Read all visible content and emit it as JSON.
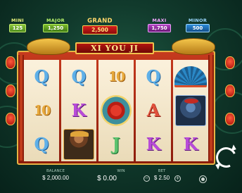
{
  "game": {
    "title": "XI YOU JI"
  },
  "jackpots": {
    "mini": {
      "label": "MINI",
      "value": "125"
    },
    "major": {
      "label": "MAJOR",
      "value": "1,250"
    },
    "grand": {
      "label": "GRAND",
      "value": "2,500"
    },
    "maxi": {
      "label": "MAXI",
      "value": "1,750"
    },
    "minor": {
      "label": "MINOR",
      "value": "500"
    }
  },
  "reels": {
    "reel1": [
      "Q",
      "10",
      "Q"
    ],
    "reel2": [
      "Q",
      "K",
      "monkey-king"
    ],
    "reel3": [
      "10",
      "scroll-scatter",
      "J"
    ],
    "reel4": [
      "Q",
      "A",
      "K"
    ],
    "reel5": [
      "fan",
      "warrior",
      "K"
    ]
  },
  "symbol_colors": {
    "Q": "#5fb0e8",
    "10": "#e8a93c",
    "K": "#b84bd8",
    "A": "#e0503c",
    "J": "#5bc26e"
  },
  "bottom_bar": {
    "balance_label": "BALANCE",
    "balance_value": "$ 2,000.00",
    "win_label": "WIN",
    "win_value": "$ 0.00",
    "bet_label": "BET",
    "bet_value": "$ 2.50",
    "bet_minus": "−",
    "bet_plus": "+"
  },
  "icons": {
    "spin": "spin-icon",
    "autoplay": "autoplay-icon"
  }
}
